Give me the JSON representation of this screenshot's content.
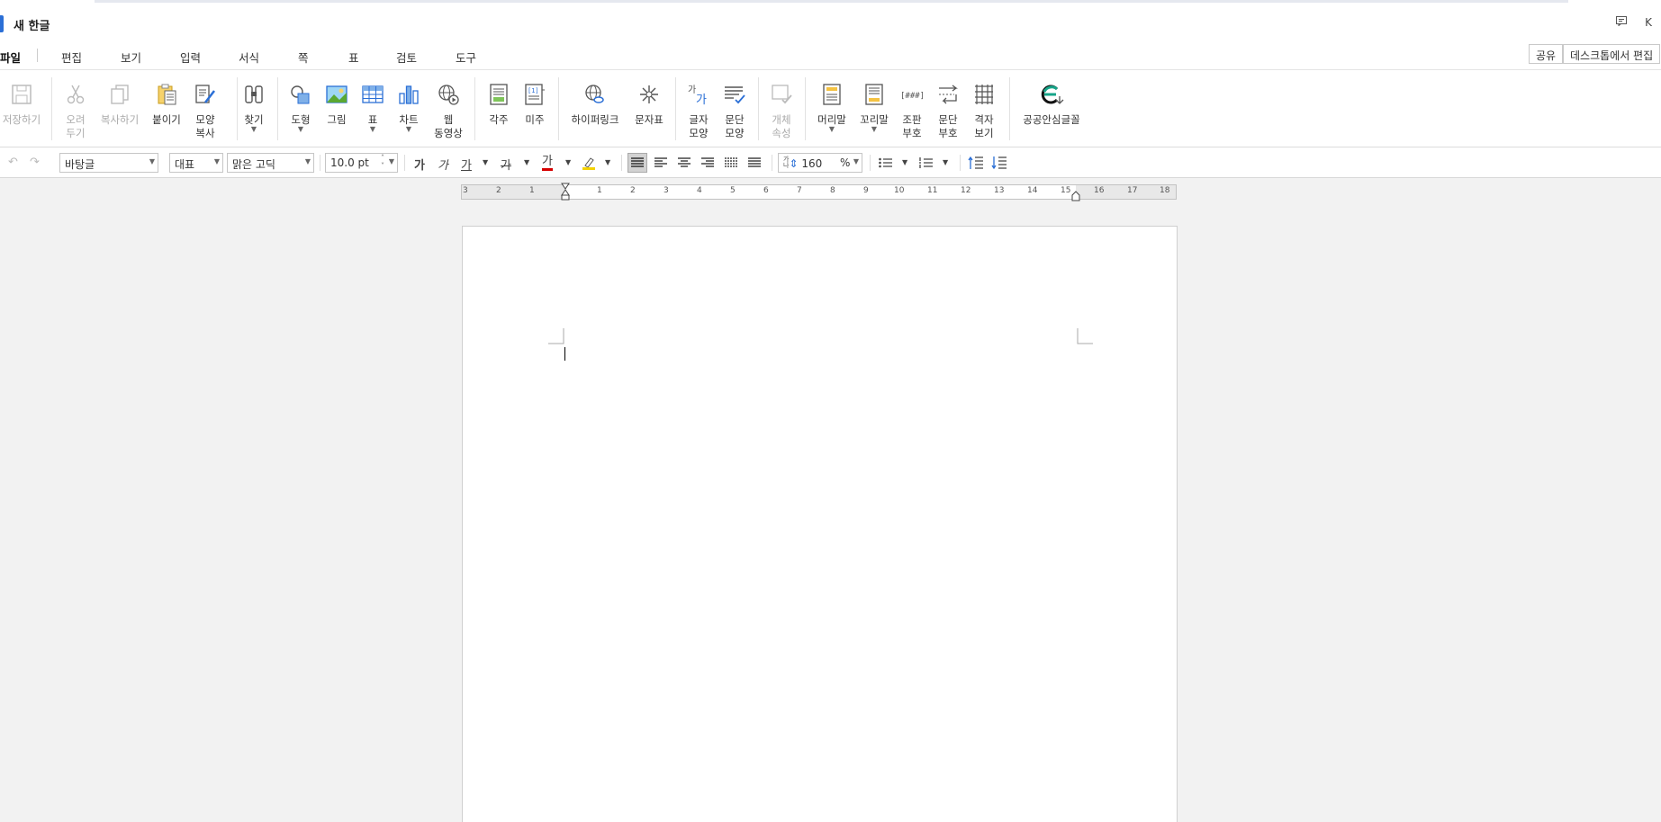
{
  "app": {
    "doc_title": "새 한글",
    "title_icons": [
      "comment-icon",
      "K"
    ]
  },
  "menu": {
    "items": [
      "파일",
      "편집",
      "보기",
      "입력",
      "서식",
      "쪽",
      "표",
      "검토",
      "도구"
    ],
    "share_label": "공유",
    "desktop_edit_label": "데스크톱에서 편집"
  },
  "ribbon": {
    "save": "저장하기",
    "cut": "오려\n두기",
    "copy": "복사하기",
    "paste": "붙이기",
    "format_copy": "모양\n복사",
    "find": "찾기",
    "shape": "도형",
    "picture": "그림",
    "table": "표",
    "chart": "차트",
    "web_video": "웹\n동영상",
    "footnote": "각주",
    "endnote": "미주",
    "hyperlink": "하이퍼링크",
    "symbols": "문자표",
    "char_shape": "글자\n모양",
    "para_shape": "문단\n모양",
    "object_props": "개체\n속성",
    "header": "머리말",
    "footer": "꼬리말",
    "composition": "조판\n부호",
    "para_mark": "문단\n부호",
    "grid_view": "격자\n보기",
    "public_font": "공공안심글꼴"
  },
  "format": {
    "style": "바탕글",
    "script": "대표",
    "font": "맑은 고딕",
    "size": "10.0",
    "size_unit": "pt",
    "bold": "가",
    "italic": "가",
    "underline": "가",
    "strike": "가",
    "font_color": "가",
    "line_spacing": "160",
    "line_spacing_unit": "%",
    "line_spacing_icon_text": "가\n나"
  },
  "ruler": {
    "labels": [
      "3",
      "2",
      "1",
      "1",
      "2",
      "3",
      "4",
      "5",
      "6",
      "7",
      "8",
      "9",
      "10",
      "11",
      "12",
      "13",
      "14",
      "15",
      "16",
      "17",
      "18"
    ]
  },
  "colors": {
    "accent": "#2b6fd6",
    "page": "#ffffff",
    "background": "#f2f2f2",
    "font_color_bar": "#d60000",
    "highlight_bar": "#f4d200"
  }
}
